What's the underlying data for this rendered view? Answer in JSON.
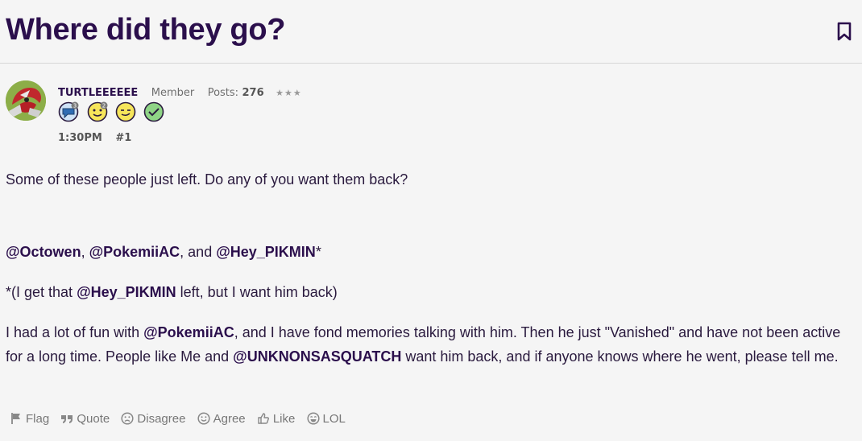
{
  "thread": {
    "title": "Where did they go?"
  },
  "post": {
    "author": {
      "username": "TURTLEEEEEE",
      "role": "Member",
      "posts_label": "Posts:",
      "posts_count": "276",
      "stars": "★★★"
    },
    "badges": [
      {
        "icon": "speech-bubble-badge-icon",
        "count": "3",
        "color": "#3a7ec6"
      },
      {
        "icon": "smile-face-badge-icon",
        "count": "2",
        "color": "#f3e05a"
      },
      {
        "icon": "wink-face-badge-icon",
        "color": "#f3e05a"
      },
      {
        "icon": "check-badge-icon",
        "color": "#6fc46a"
      }
    ],
    "time": "1:30PM",
    "number": "#1",
    "body": {
      "p1": "Some of these people just left. Do any of you want them back?",
      "p2": {
        "m1": "@Octowen",
        "s1": ", ",
        "m2": "@PokemiiAC",
        "s2": ", and ",
        "m3": "@Hey_PIKMIN",
        "s3": "*"
      },
      "p3": {
        "s1": "*(I get that ",
        "m1": "@Hey_PIKMIN",
        "s2": " left, but I want him back)"
      },
      "p4": {
        "s1": "I had a lot of fun with ",
        "m1": "@PokemiiAC",
        "s2": ", and I have fond memories talking with him. Then he just \"Vanished\" and have not been active for a long time. People like Me and ",
        "m2": "@UNKNONSASQUATCH",
        "s3": " want him back, and if anyone knows where he went, please tell me."
      }
    },
    "actions": {
      "flag": "Flag",
      "quote": "Quote",
      "disagree": "Disagree",
      "agree": "Agree",
      "like": "Like",
      "lol": "LOL"
    }
  }
}
